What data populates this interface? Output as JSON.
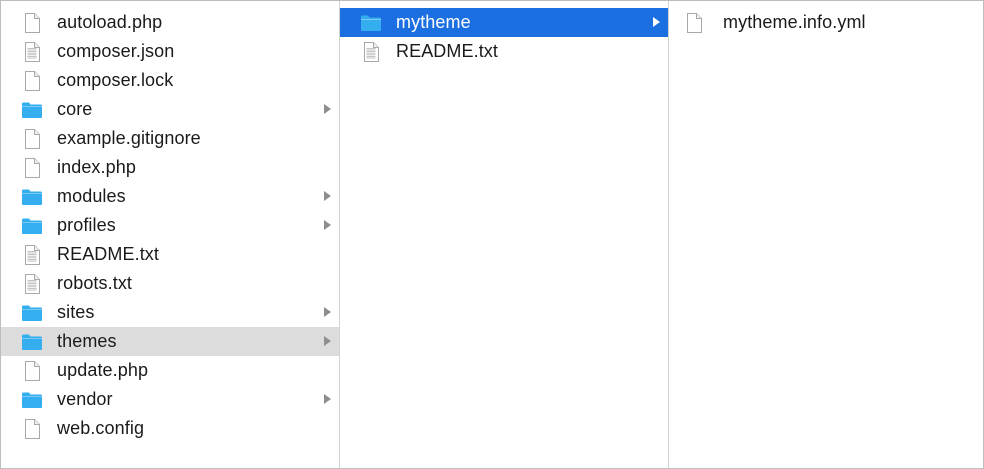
{
  "colors": {
    "folder": "#35aef0",
    "selection_active": "#1c6fe0",
    "selection_inactive": "#dcdcdc"
  },
  "columns": [
    {
      "items": [
        {
          "label": "autoload.php",
          "icon": "document-icon"
        },
        {
          "label": "composer.json",
          "icon": "text-file-icon"
        },
        {
          "label": "composer.lock",
          "icon": "document-icon"
        },
        {
          "label": "core",
          "icon": "folder-icon",
          "has_children": true
        },
        {
          "label": "example.gitignore",
          "icon": "document-icon"
        },
        {
          "label": "index.php",
          "icon": "document-icon"
        },
        {
          "label": "modules",
          "icon": "folder-icon",
          "has_children": true
        },
        {
          "label": "profiles",
          "icon": "folder-icon",
          "has_children": true
        },
        {
          "label": "README.txt",
          "icon": "text-file-icon"
        },
        {
          "label": "robots.txt",
          "icon": "text-file-icon"
        },
        {
          "label": "sites",
          "icon": "folder-icon",
          "has_children": true
        },
        {
          "label": "themes",
          "icon": "folder-icon",
          "has_children": true,
          "selected": "inactive"
        },
        {
          "label": "update.php",
          "icon": "document-icon"
        },
        {
          "label": "vendor",
          "icon": "folder-icon",
          "has_children": true
        },
        {
          "label": "web.config",
          "icon": "document-icon"
        }
      ]
    },
    {
      "items": [
        {
          "label": "mytheme",
          "icon": "folder-icon",
          "has_children": true,
          "selected": "active"
        },
        {
          "label": "README.txt",
          "icon": "text-file-icon"
        }
      ]
    },
    {
      "items": [
        {
          "label": "mytheme.info.yml",
          "icon": "document-icon"
        }
      ]
    }
  ]
}
